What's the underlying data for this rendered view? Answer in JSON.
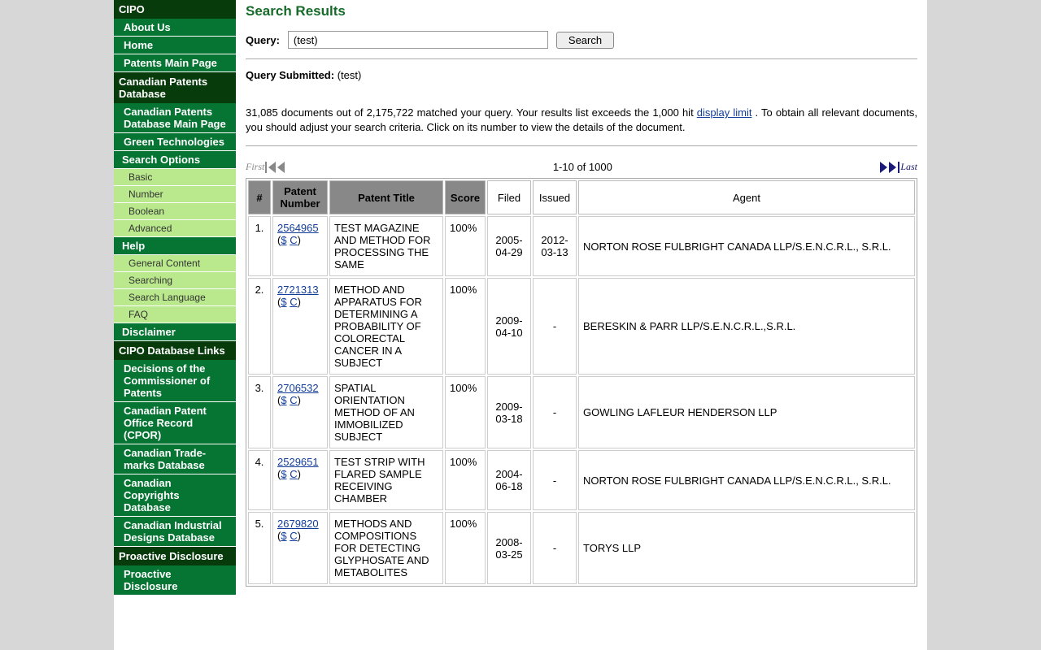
{
  "sidebar": {
    "top_header": "CIPO",
    "top": [
      "About Us",
      "Home",
      "Patents Main Page"
    ],
    "db_header": "Canadian Patents Database",
    "db": [
      "Canadian Patents Database Main Page",
      "Green Technologies"
    ],
    "search_header": "Search Options",
    "search": [
      "Basic",
      "Number",
      "Boolean",
      "Advanced"
    ],
    "help_header": "Help",
    "help": [
      "General Content",
      "Searching",
      "Search Language",
      "FAQ"
    ],
    "disclaimer": "Disclaimer",
    "links_header": "CIPO Database Links",
    "links": [
      "Decisions of the Commissioner of Patents",
      "Canadian Patent Office Record (CPOR)",
      "Canadian Trade-marks Database",
      "Canadian Copyrights Database",
      "Canadian Industrial Designs Database"
    ],
    "proactive_header": "Proactive Disclosure",
    "proactive": [
      "Proactive Disclosure"
    ]
  },
  "main": {
    "title": "Search Results",
    "query_label": "Query:",
    "query_value": "(test)",
    "search_btn": "Search",
    "submitted_label": "Query Submitted:",
    "submitted_value": "(test)",
    "msg_a": "31,085 documents out of 2,175,722 matched your query. Your results list exceeds the 1,000 hit ",
    "msg_link": "display limit",
    "msg_b": " . To obtain all relevant documents, you should adjust your search criteria. Click on its number to view the details of the document.",
    "first": "First",
    "range": "1-10 of 1000",
    "last": "Last",
    "dollar": "$",
    "c": "C",
    "cols": {
      "num": "#",
      "patent": "Patent Number",
      "title": "Patent Title",
      "score": "Score",
      "filed": "Filed",
      "issued": "Issued",
      "agent": "Agent"
    },
    "rows": [
      {
        "n": "1.",
        "pat": "2564965",
        "title": "TEST MAGAZINE AND METHOD FOR PROCESSING THE SAME",
        "score": "100%",
        "filed": "2005-04-29",
        "issued": "2012-03-13",
        "agent": "NORTON ROSE FULBRIGHT CANADA LLP/S.E.N.C.R.L., S.R.L."
      },
      {
        "n": "2.",
        "pat": "2721313",
        "title": "METHOD AND APPARATUS FOR DETERMINING A PROBABILITY OF COLORECTAL CANCER IN A SUBJECT",
        "score": "100%",
        "filed": "2009-04-10",
        "issued": "-",
        "agent": "BERESKIN & PARR LLP/S.E.N.C.R.L.,S.R.L."
      },
      {
        "n": "3.",
        "pat": "2706532",
        "title": "SPATIAL ORIENTATION METHOD OF AN IMMOBILIZED SUBJECT",
        "score": "100%",
        "filed": "2009-03-18",
        "issued": "-",
        "agent": "GOWLING LAFLEUR HENDERSON LLP"
      },
      {
        "n": "4.",
        "pat": "2529651",
        "title": "TEST STRIP WITH FLARED SAMPLE RECEIVING CHAMBER",
        "score": "100%",
        "filed": "2004-06-18",
        "issued": "-",
        "agent": "NORTON ROSE FULBRIGHT CANADA LLP/S.E.N.C.R.L., S.R.L."
      },
      {
        "n": "5.",
        "pat": "2679820",
        "title": "METHODS AND COMPOSITIONS FOR DETECTING GLYPHOSATE AND METABOLITES",
        "score": "100%",
        "filed": "2008-03-25",
        "issued": "-",
        "agent": "TORYS LLP"
      }
    ]
  }
}
